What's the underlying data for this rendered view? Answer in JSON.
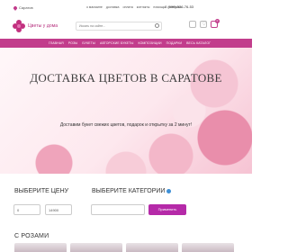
{
  "topbar": {
    "city": "Саратов",
    "links": [
      "о магазине",
      "доставка",
      "оплата",
      "контакты",
      "помощь",
      "контакты"
    ],
    "phone": "8 (999) 526-76-53"
  },
  "header": {
    "logo_text": "Цветы у дома",
    "search_placeholder": "Искать на сайте...",
    "cart_count": "0"
  },
  "nav": {
    "items": [
      "ГЛАВНАЯ",
      "РОЗЫ",
      "БУКЕТЫ",
      "АВТОРСКИЕ БУКЕТЫ",
      "КОМПОЗИЦИИ",
      "ПОДАРКИ",
      "ВЕСЬ КАТАЛОГ"
    ]
  },
  "hero": {
    "title": "ДОСТАВКА ЦВЕТОВ В САРАТОВЕ",
    "subtitle": "Доставим букет свежих цветов, подарок и открытку за 2 минут!"
  },
  "filters": {
    "price_label": "ВЫБЕРИТЕ ЦЕНУ",
    "category_label": "ВЫБЕРИТЕ КАТЕГОРИИ",
    "price_from": "0",
    "price_to": "14900",
    "apply_label": "Применить"
  },
  "section": {
    "title": "С РОЗАМИ"
  },
  "colors": {
    "brand": "#c23d8c",
    "button": "#b52aa8"
  }
}
